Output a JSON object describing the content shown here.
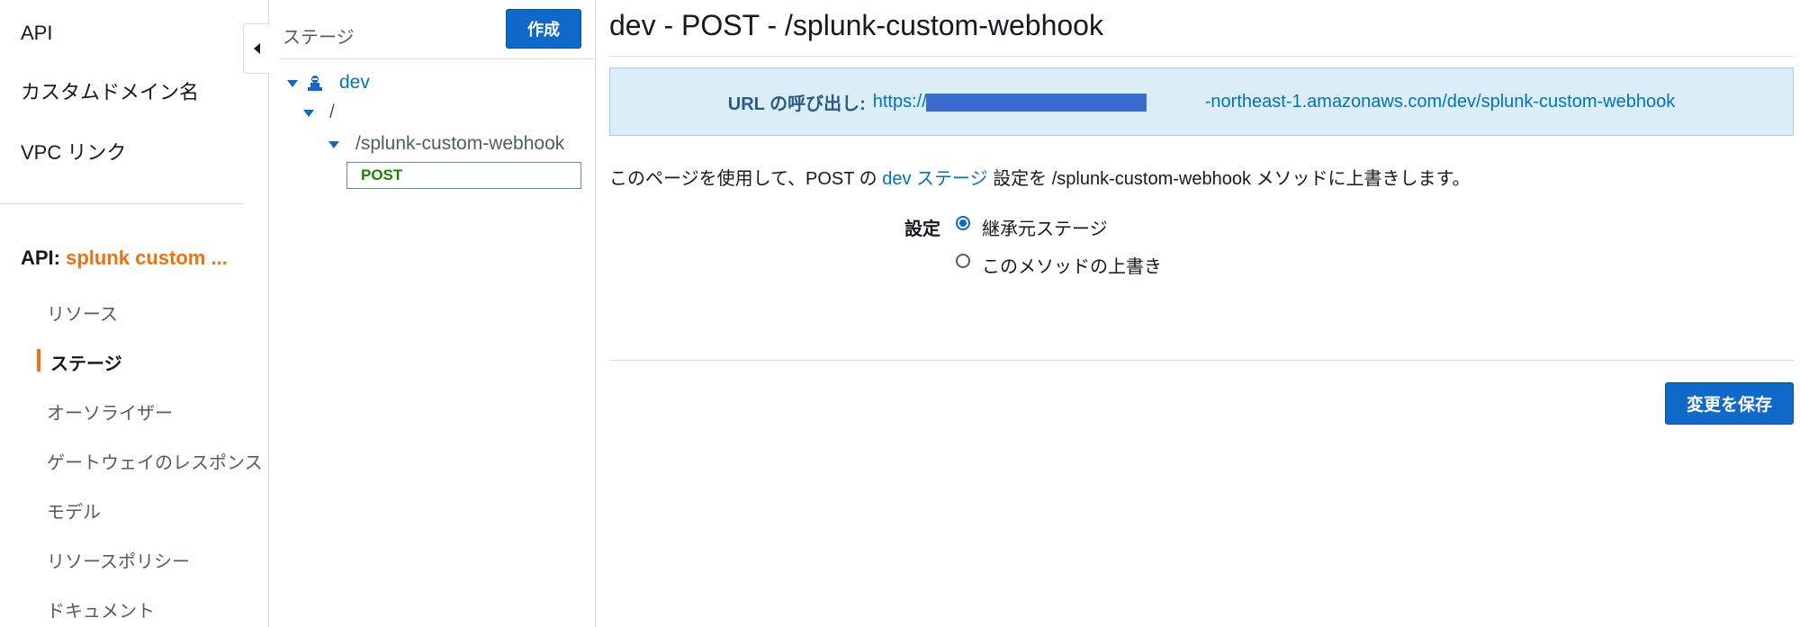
{
  "nav": {
    "top_items": [
      {
        "label": "API"
      },
      {
        "label": "カスタムドメイン名"
      },
      {
        "label": "VPC リンク"
      }
    ],
    "api_prefix": "API:",
    "api_name": "splunk custom ...",
    "sub_items": [
      {
        "label": "リソース"
      },
      {
        "label": "ステージ",
        "active": true
      },
      {
        "label": "オーソライザー"
      },
      {
        "label": "ゲートウェイのレスポンス"
      },
      {
        "label": "モデル"
      },
      {
        "label": "リソースポリシー"
      },
      {
        "label": "ドキュメント"
      }
    ],
    "collapse_icon": "caret-left-icon"
  },
  "stages": {
    "title": "ステージ",
    "create_label": "作成",
    "tree": {
      "stage": "dev",
      "stage_icon": "stage-icon",
      "root": "/",
      "resource": "/splunk-custom-webhook",
      "method": "POST"
    }
  },
  "main": {
    "title": "dev - POST - /splunk-custom-webhook",
    "invoke_url_label": "URL の呼び出し:",
    "invoke_url_prefix": "https://",
    "invoke_url_suffix": "-northeast-1.amazonaws.com/dev/splunk-custom-webhook",
    "description": {
      "part1": "このページを使用して、POST の",
      "link": "dev ステージ",
      "part2": "設定を /splunk-custom-webhook メソッドに上書きします。"
    },
    "setting_label": "設定",
    "options": [
      {
        "label": "継承元ステージ",
        "selected": true
      },
      {
        "label": "このメソッドの上書き",
        "selected": false
      }
    ],
    "save_label": "変更を保存"
  },
  "colors": {
    "accent_orange": "#ec7211",
    "primary_blue": "#0f69c8",
    "link_blue": "#0073bb",
    "info_bg": "#dbeef7",
    "method_green": "#1d8102"
  }
}
